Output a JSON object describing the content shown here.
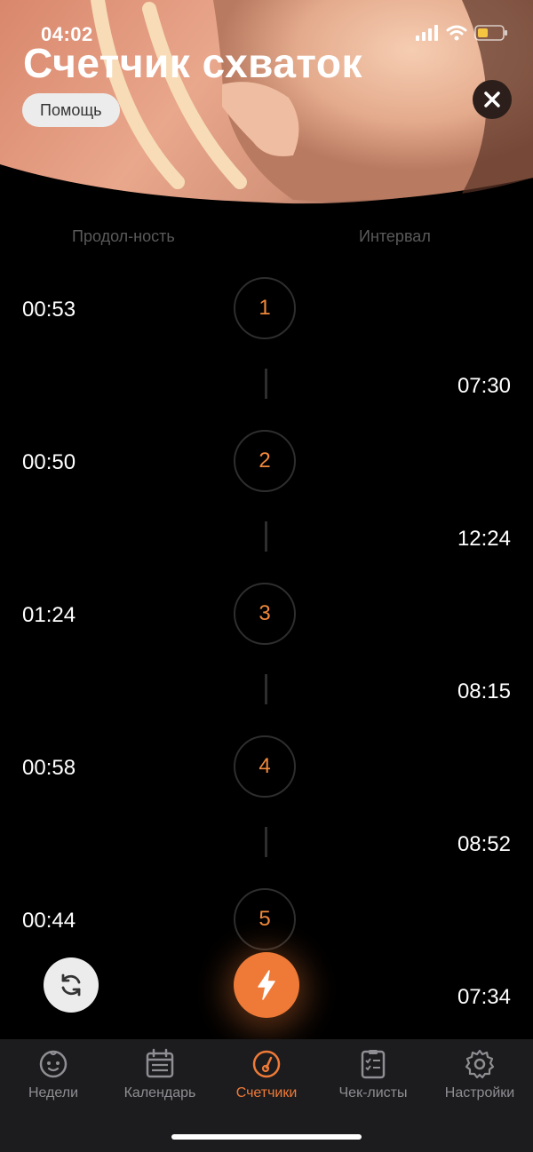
{
  "status_bar": {
    "time": "04:02"
  },
  "header": {
    "title": "Счетчик схваток",
    "help_label": "Помощь"
  },
  "columns": {
    "duration": "Продол-ность",
    "interval": "Интервал"
  },
  "contractions": [
    {
      "number": "1",
      "duration": "00:53",
      "interval": "07:30"
    },
    {
      "number": "2",
      "duration": "00:50",
      "interval": "12:24"
    },
    {
      "number": "3",
      "duration": "01:24",
      "interval": "08:15"
    },
    {
      "number": "4",
      "duration": "00:58",
      "interval": "08:52"
    },
    {
      "number": "5",
      "duration": "00:44",
      "interval": "07:34"
    }
  ],
  "tabs": [
    {
      "label": "Недели",
      "icon": "baby-face-icon"
    },
    {
      "label": "Календарь",
      "icon": "calendar-icon"
    },
    {
      "label": "Счетчики",
      "icon": "gauge-icon",
      "active": true
    },
    {
      "label": "Чек-листы",
      "icon": "checklist-icon"
    },
    {
      "label": "Настройки",
      "icon": "gear-icon"
    }
  ],
  "colors": {
    "accent": "#ef7a37",
    "number": "#f0883a",
    "background": "#000000",
    "tabbar": "#1c1c1e"
  }
}
